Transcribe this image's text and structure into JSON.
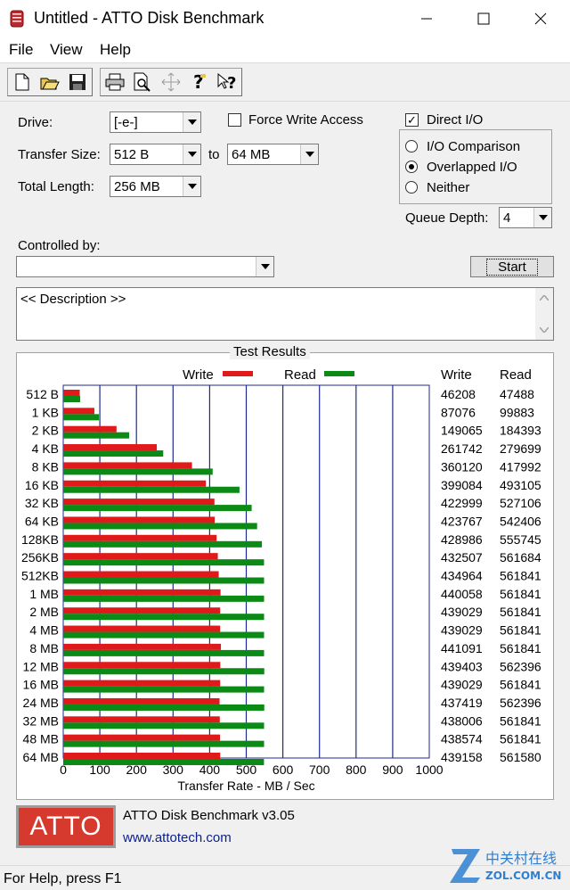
{
  "window": {
    "title": "Untitled - ATTO Disk Benchmark"
  },
  "menu": [
    "File",
    "View",
    "Help"
  ],
  "toolbar": {
    "buttons": [
      "new-icon",
      "open-icon",
      "save-icon",
      "print-icon",
      "print-preview-icon",
      "move-icon",
      "about-icon",
      "context-help-icon"
    ]
  },
  "settings": {
    "drive_label": "Drive:",
    "drive_value": "[-e-]",
    "transfer_size_label": "Transfer Size:",
    "transfer_from": "512 B",
    "to_label": "to",
    "transfer_to": "64 MB",
    "total_length_label": "Total Length:",
    "total_length_value": "256 MB",
    "force_write_label": "Force Write Access",
    "force_write_checked": false,
    "direct_io_label": "Direct I/O",
    "direct_io_checked": true,
    "io_options": [
      {
        "label": "I/O Comparison",
        "selected": false
      },
      {
        "label": "Overlapped I/O",
        "selected": true
      },
      {
        "label": "Neither",
        "selected": false
      }
    ],
    "queue_depth_label": "Queue Depth:",
    "queue_depth_value": "4",
    "controlled_by_label": "Controlled by:",
    "controlled_by_value": "",
    "start_label": "Start",
    "description": "<< Description >>"
  },
  "results": {
    "title": "Test Results",
    "write_col": "Write",
    "read_col": "Read"
  },
  "chart_data": {
    "type": "bar",
    "orientation": "horizontal",
    "xlabel": "Transfer Rate - MB / Sec",
    "xlim": [
      0,
      1000
    ],
    "xticks": [
      0,
      100,
      200,
      300,
      400,
      500,
      600,
      700,
      800,
      900,
      1000
    ],
    "legend": "top",
    "grid": true,
    "categories": [
      "512 B",
      "1 KB",
      "2 KB",
      "4 KB",
      "8 KB",
      "16 KB",
      "32 KB",
      "64 KB",
      "128KB",
      "256KB",
      "512KB",
      "1 MB",
      "2 MB",
      "4 MB",
      "8 MB",
      "12 MB",
      "16 MB",
      "24 MB",
      "32 MB",
      "48 MB",
      "64 MB"
    ],
    "series": [
      {
        "name": "Write",
        "color": "#e0191b",
        "values": [
          46208,
          87076,
          149065,
          261742,
          360120,
          399084,
          422999,
          423767,
          428986,
          432507,
          434964,
          440058,
          439029,
          439029,
          441091,
          439403,
          439029,
          437419,
          438006,
          438574,
          439158
        ]
      },
      {
        "name": "Read",
        "color": "#0b8a16",
        "values": [
          47488,
          99883,
          184393,
          279699,
          417992,
          493105,
          527106,
          542406,
          555745,
          561684,
          561841,
          561841,
          561841,
          561841,
          561841,
          562396,
          561841,
          562396,
          561841,
          561841,
          561580
        ]
      }
    ]
  },
  "footer": {
    "logo": "ATTO",
    "product": "ATTO Disk Benchmark v3.05",
    "url": "www.attotech.com"
  },
  "watermark": {
    "cn": "中关村在线",
    "site": "ZOL.COM.CN"
  },
  "status": {
    "text": "For Help, press F1"
  },
  "colors": {
    "bar_write": "#e0191b",
    "bar_read": "#0b8a16",
    "gridline": "#1f2a8c",
    "logo_red": "#d63a2f",
    "link": "#0a1e8c"
  }
}
